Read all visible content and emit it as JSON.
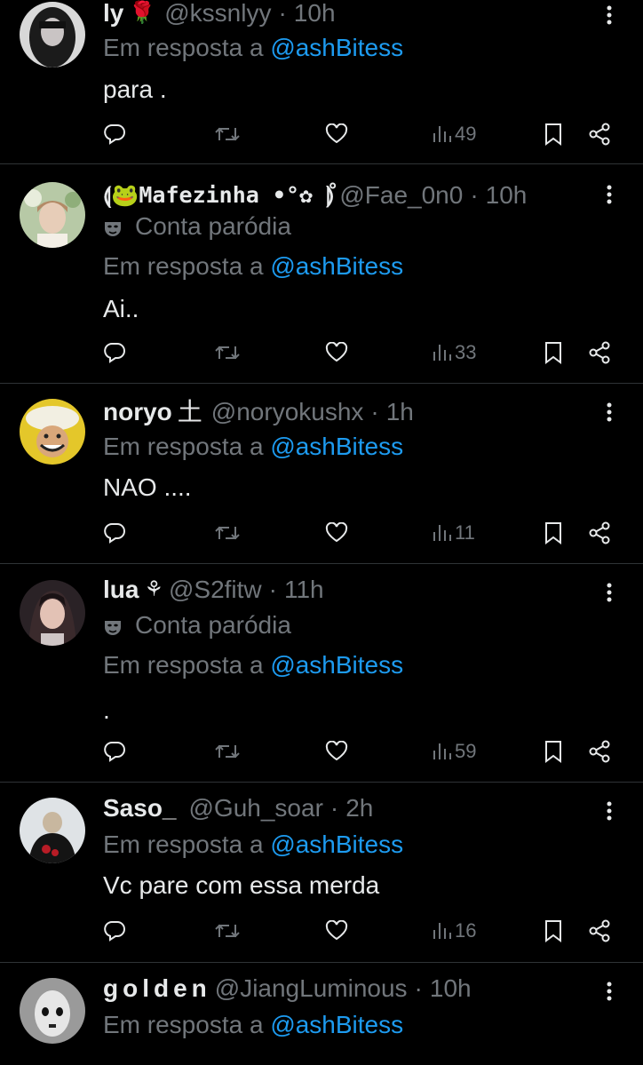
{
  "reply_prefix": "Em resposta a",
  "colors": {
    "background": "#000000",
    "text": "#e7e9ea",
    "muted": "#71767b",
    "link": "#1d9bf0",
    "divider": "#2f3336"
  },
  "icons": {
    "reply": "reply-icon",
    "retweet": "retweet-icon",
    "like": "heart-icon",
    "views": "views-icon",
    "bookmark": "bookmark-icon",
    "share": "share-icon",
    "more": "more-vertical-icon",
    "parody": "parody-mask-icon"
  },
  "tweets": [
    {
      "display_name": "ly",
      "name_decoration": "🌹",
      "handle": "@kssnlyy",
      "time": "10h",
      "parody_label": "",
      "reply_to": "@ashBitess",
      "text": "para .",
      "views": "49"
    },
    {
      "display_name": "⟬🐸Mafezinha •°✿ ̊⟭",
      "name_decoration": "",
      "handle": "@Fae_0n0",
      "time": "10h",
      "parody_label": "Conta paródia",
      "reply_to": "@ashBitess",
      "text": "Ai..",
      "views": "33"
    },
    {
      "display_name": "noryo",
      "name_decoration": "土",
      "handle": "@noryokushx",
      "time": "1h",
      "parody_label": "",
      "reply_to": "@ashBitess",
      "text": "NAO ....",
      "views": "11"
    },
    {
      "display_name": "lua",
      "name_decoration": "⚘",
      "handle": "@S2fitw",
      "time": "11h",
      "parody_label": "Conta paródia",
      "reply_to": "@ashBitess",
      "text": ".",
      "views": "59"
    },
    {
      "display_name": "Saso_",
      "name_decoration": "",
      "handle": "@Guh_soar",
      "time": "2h",
      "parody_label": "",
      "reply_to": "@ashBitess",
      "text": "Vc pare com essa merda",
      "views": "16"
    },
    {
      "display_name": "golden",
      "name_decoration": "",
      "handle": "@JiangLuminous",
      "time": "10h",
      "parody_label": "",
      "reply_to": "@ashBitess",
      "text": "",
      "views": ""
    }
  ]
}
